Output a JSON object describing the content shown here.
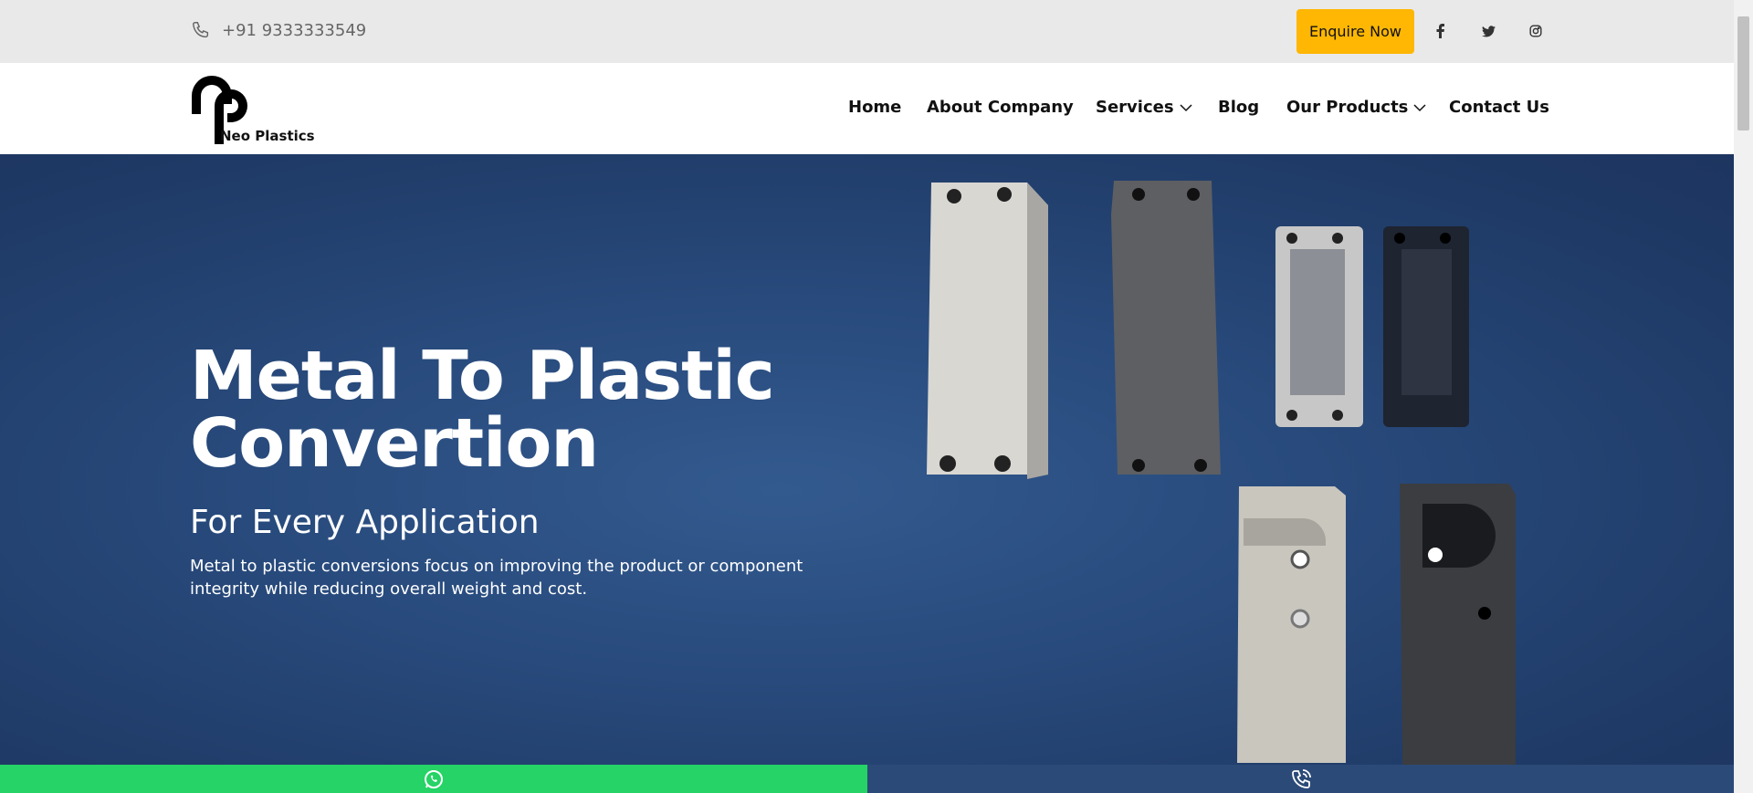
{
  "topbar": {
    "phone": "+91 9333333549",
    "enquire_label": "Enquire Now",
    "social": [
      "f",
      "t",
      "ig"
    ]
  },
  "brand": {
    "name": "Neo Plastics"
  },
  "nav": {
    "home": "Home",
    "about": "About Company",
    "services": "Services",
    "blog": "Blog",
    "products": "Our Products",
    "contact": "Contact Us"
  },
  "hero": {
    "title_line1": "Metal To Plastic",
    "title_line2": "Convertion",
    "subtitle": "For Every Application",
    "description": "Metal to plastic conversions focus on improving the product or component integrity while reducing overall weight and cost."
  },
  "colors": {
    "accent": "#ffb703",
    "hero_bg": "#284a7c",
    "whatsapp": "#25d366",
    "call_bar": "#2b4a78"
  },
  "icons": {
    "phone": "phone-icon",
    "facebook": "facebook-icon",
    "twitter": "twitter-icon",
    "instagram": "instagram-icon",
    "whatsapp": "whatsapp-icon",
    "call": "call-icon"
  }
}
